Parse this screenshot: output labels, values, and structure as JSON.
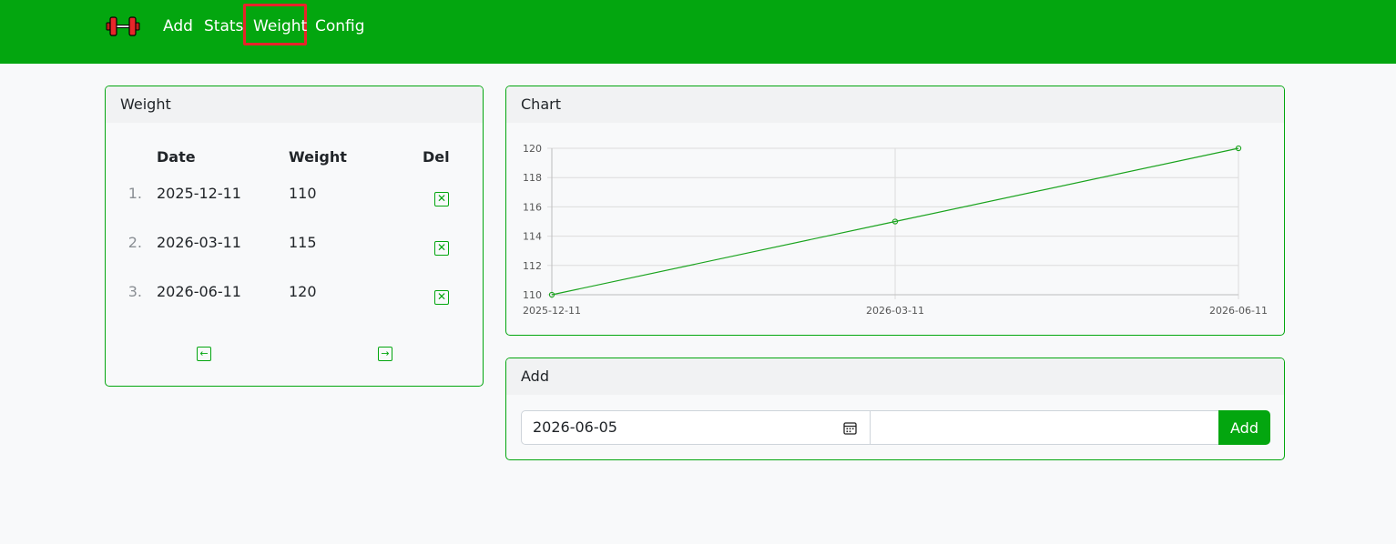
{
  "nav": {
    "brand_icon": "dumbbell-icon",
    "links": [
      "Add",
      "Stats",
      "Weight",
      "Config"
    ],
    "active": "Weight"
  },
  "weight_card": {
    "title": "Weight",
    "columns": [
      "Date",
      "Weight",
      "Del"
    ],
    "rows": [
      {
        "index": "1.",
        "date": "2025-12-11",
        "weight": "110"
      },
      {
        "index": "2.",
        "date": "2026-03-11",
        "weight": "115"
      },
      {
        "index": "3.",
        "date": "2026-06-11",
        "weight": "120"
      }
    ],
    "delete_icon": "close-box-icon",
    "prev_icon": "arrow-left-box-icon",
    "next_icon": "arrow-right-box-icon"
  },
  "chart_card": {
    "title": "Chart"
  },
  "chart_data": {
    "type": "line",
    "x": [
      "2025-12-11",
      "2026-03-11",
      "2026-06-11"
    ],
    "series": [
      {
        "values": [
          110,
          115,
          120
        ],
        "color": "#1aa31e"
      }
    ],
    "ylim": [
      110,
      120
    ],
    "yticks": [
      110,
      112,
      114,
      116,
      118,
      120
    ],
    "grid": true,
    "title": "",
    "xlabel": "",
    "ylabel": ""
  },
  "add_card": {
    "title": "Add",
    "date_value": "2026-06-05",
    "weight_value": "",
    "button_label": "Add"
  },
  "colors": {
    "brand_green": "#03a60f",
    "active_outline": "#e8232a"
  }
}
